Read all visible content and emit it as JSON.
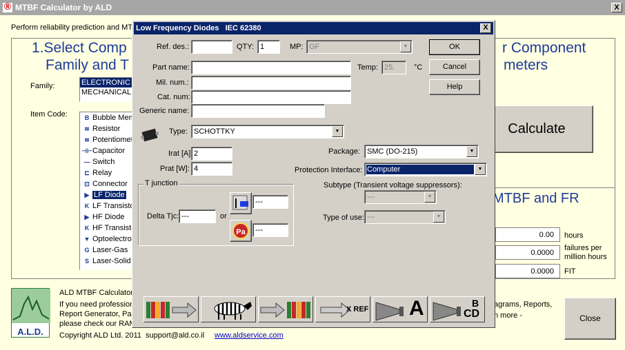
{
  "window": {
    "title": "MTBF Calculator by ALD",
    "close": "X"
  },
  "main": {
    "intro": "Perform reliability prediction and MTB",
    "step1_line1": "1.Select Comp",
    "step1_line2": "Family and T",
    "step2_line1": "r Component",
    "step2_line2": "meters",
    "family_label": "Family:",
    "families": [
      "ELECTRONIC",
      "MECHANICAL"
    ],
    "item_code_label": "Item Code:",
    "items": [
      {
        "icon": "B",
        "label": "Bubble Memory"
      },
      {
        "icon": "≋",
        "label": "Resistor"
      },
      {
        "icon": "≋",
        "label": "Potentiometer"
      },
      {
        "icon": "⊣⊢",
        "label": "Capacitor"
      },
      {
        "icon": "—",
        "label": "Switch"
      },
      {
        "icon": "⊏",
        "label": "Relay"
      },
      {
        "icon": "⊡",
        "label": "Connector"
      },
      {
        "icon": "▶",
        "label": "LF Diode"
      },
      {
        "icon": "K",
        "label": "LF Transistor"
      },
      {
        "icon": "▶",
        "label": "HF Diode"
      },
      {
        "icon": "K",
        "label": "HF Transistor"
      },
      {
        "icon": "▼",
        "label": "Optoelectronic"
      },
      {
        "icon": "G",
        "label": "Laser-Gas"
      },
      {
        "icon": "S",
        "label": "Laser-Solid"
      }
    ],
    "calculate": "Calculate",
    "results_title": "MTBF and FR",
    "results": [
      {
        "value": "0.00",
        "unit": "hours"
      },
      {
        "value": "0.0000",
        "unit": "failures per\nmillion hours"
      },
      {
        "value": "0.0000",
        "unit": "FIT"
      }
    ],
    "footer": {
      "title": "ALD MTBF Calculator",
      "line1": "If you need professiona",
      "line2": "Report Generator, Para",
      "line3": "please check our RAM",
      "right1": "agrams, Reports,",
      "right2": "n more -",
      "copyright": "Copyright ALD Ltd. 2011",
      "email": "support@ald.co.il",
      "url": "www.aldservice.com",
      "logo": "A.L.D.",
      "close": "Close"
    }
  },
  "dialog": {
    "title": "Low Frequency Diodes   IEC 62380",
    "close": "X",
    "ref_des_label": "Ref. des.:",
    "ref_des": "",
    "qty_label": "QTY:",
    "qty": "1",
    "mp_label": "MP:",
    "mp": "GF",
    "part_name_label": "Part name:",
    "part_name": "",
    "temp_label": "Temp:",
    "temp": "25.",
    "temp_unit": "°C",
    "mil_num_label": "Mil. num.:",
    "mil_num": "",
    "cat_num_label": "Cat. num:",
    "cat_num": "",
    "generic_label": "Generic name:",
    "generic": "",
    "type_label": "Type:",
    "type": "SCHOTTKY",
    "irat_label": "Irat [A]:",
    "irat": "2",
    "prat_label": "Prat [W]:",
    "prat": "4",
    "package_label": "Package:",
    "package": "SMC (DO-215)",
    "protection_label": "Protection Interface:",
    "protection": "Computer",
    "subtype_label": "Subtype (Transient voltage suppressors):",
    "subtype": "---",
    "type_of_use_label": "Type of use:",
    "type_of_use": "---",
    "tj_group": "T junction",
    "delta_label": "Delta Tjc:",
    "delta": "---",
    "or_label": "or",
    "tj_case": "---",
    "tj_pa": "---",
    "pa_glyph": "Pa",
    "ok": "OK",
    "cancel": "Cancel",
    "help": "Help",
    "xref": "X REF",
    "find_a": "A",
    "find_bcd_top": "B",
    "find_bcd_bottom": "CD"
  }
}
